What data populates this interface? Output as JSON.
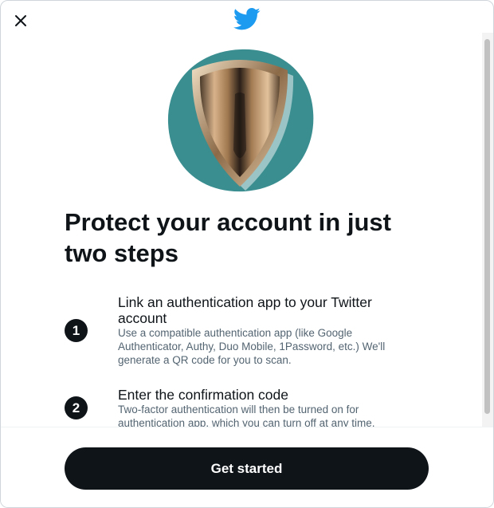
{
  "header": {
    "close_icon": "close-icon",
    "logo_icon": "twitter-bird-icon",
    "brand_color": "#1d9bf0"
  },
  "hero": {
    "icon": "shield-icon",
    "circle_color": "#3a8e90"
  },
  "title": "Protect your account in just two steps",
  "steps": [
    {
      "number": "1",
      "title": "Link an authentication app to your Twitter account",
      "description": "Use a compatible authentication app (like Google Authenticator, Authy, Duo Mobile, 1Password, etc.) We'll generate a QR code for you to scan."
    },
    {
      "number": "2",
      "title": "Enter the confirmation code",
      "description": "Two-factor authentication will then be turned on for authentication app, which you can turn off at any time."
    }
  ],
  "footer": {
    "button_label": "Get started"
  }
}
